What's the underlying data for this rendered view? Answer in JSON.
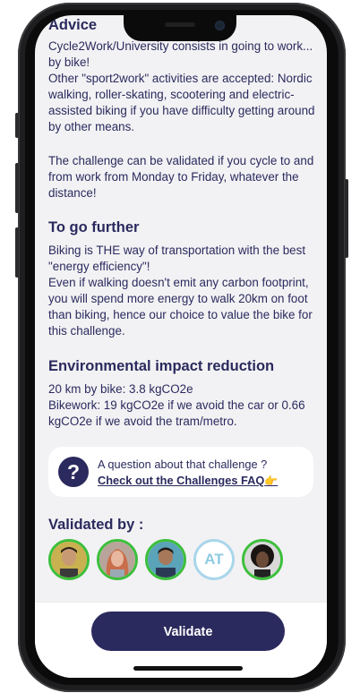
{
  "advice": {
    "heading": "Advice",
    "paragraphs": [
      "Cycle2Work/University consists in going to work... by bike!\nOther  \"sport2work\" activities are accepted: Nordic walking, roller-skating,  scootering and electric-assisted biking if you have difficulty getting  around by other means.",
      "The challenge can be validated if you cycle to and from work from Monday to Friday, whatever the distance!"
    ]
  },
  "further": {
    "heading": "To go further",
    "paragraph": "Biking is THE way of transportation with the best \"energy efficiency\"!\nEven if walking doesn't emit any carbon footprint, you will spend more  energy to walk 20km on foot than  biking, hence our choice to value the bike for this challenge."
  },
  "impact": {
    "heading": "Environmental impact reduction",
    "paragraph": "20 km by bike: 3.8 kgCO2e\nBikework: 19 kgCO2e if we avoid the car or 0.66 kgCO2e if we avoid the tram/metro."
  },
  "faq": {
    "icon": "question-icon",
    "icon_glyph": "?",
    "question": "A question about that challenge ?",
    "link_label": "Check out the Challenges FAQ",
    "emoji": "👉"
  },
  "validated": {
    "title": "Validated by :",
    "avatars": [
      {
        "type": "photo",
        "name": "avatar-1"
      },
      {
        "type": "photo",
        "name": "avatar-2"
      },
      {
        "type": "photo",
        "name": "avatar-3"
      },
      {
        "type": "initials",
        "initials": "AT"
      },
      {
        "type": "photo",
        "name": "avatar-5"
      }
    ]
  },
  "footer": {
    "validate_label": "Validate"
  },
  "colors": {
    "primary": "#2b2a5e",
    "validated_ring": "#3cbf3c",
    "initials_ring": "#a9d6ea",
    "background": "#f2f2f4"
  }
}
